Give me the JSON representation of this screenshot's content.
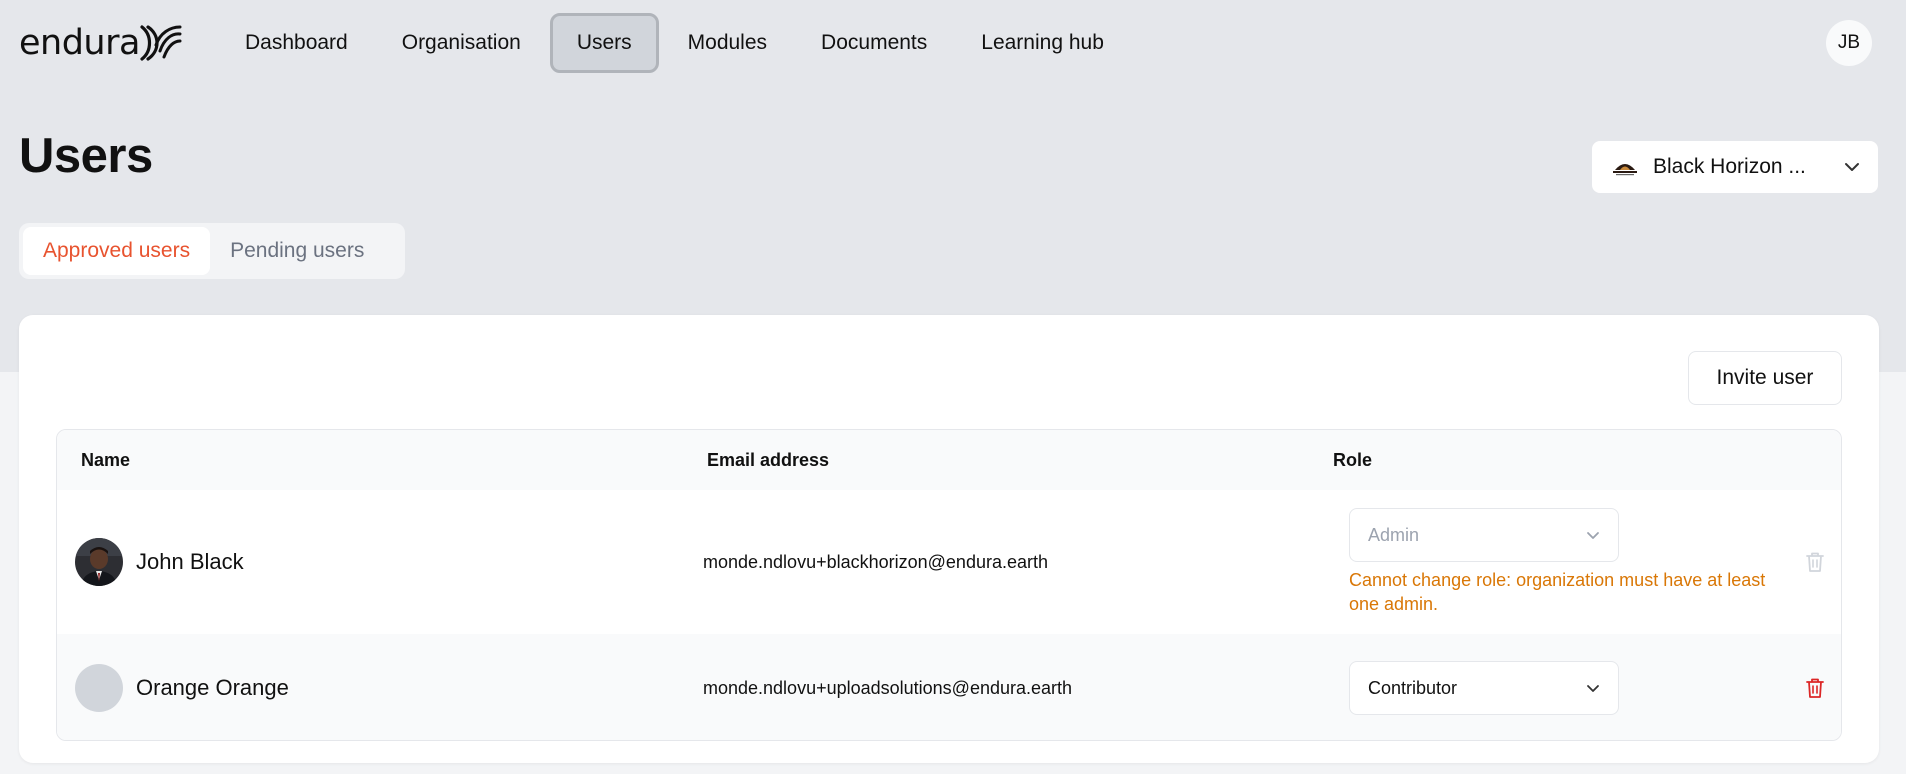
{
  "header": {
    "logo_text": "endura",
    "nav": [
      {
        "label": "Dashboard",
        "active": false
      },
      {
        "label": "Organisation",
        "active": false
      },
      {
        "label": "Users",
        "active": true
      },
      {
        "label": "Modules",
        "active": false
      },
      {
        "label": "Documents",
        "active": false
      },
      {
        "label": "Learning hub",
        "active": false
      }
    ],
    "avatar_initials": "JB"
  },
  "page": {
    "title": "Users",
    "org_selector": {
      "label": "Black Horizon ...",
      "icon": "org-logo",
      "chevron": "chevron-down-icon"
    }
  },
  "tabs": [
    {
      "label": "Approved users",
      "active": true
    },
    {
      "label": "Pending users",
      "active": false
    }
  ],
  "toolbar": {
    "invite_label": "Invite user"
  },
  "table": {
    "columns": [
      "Name",
      "Email address",
      "Role"
    ],
    "rows": [
      {
        "name": "John Black",
        "email": "monde.ndlovu+blackhorizon@endura.earth",
        "role": "Admin",
        "role_disabled": true,
        "warning": "Cannot change role: organization must have at least one admin.",
        "delete_enabled": false
      },
      {
        "name": "Orange Orange",
        "email": "monde.ndlovu+uploadsolutions@endura.earth",
        "role": "Contributor",
        "role_disabled": false,
        "warning": "",
        "delete_enabled": true
      }
    ]
  },
  "colors": {
    "accent": "#e8532f",
    "warning": "#d97706",
    "danger": "#dc2626",
    "nav_active_bg": "#d1d5db"
  }
}
